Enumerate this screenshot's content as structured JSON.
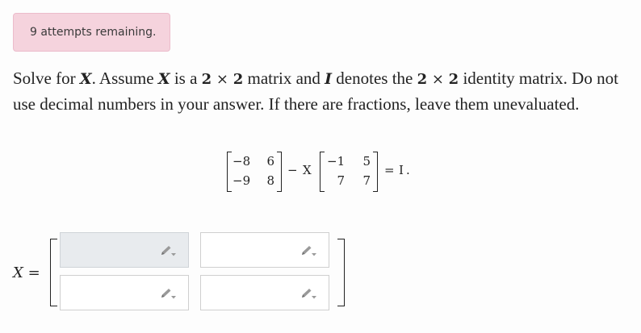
{
  "attempts": {
    "label": "9 attempts remaining."
  },
  "problem": {
    "t1": "Solve for ",
    "x1": "X",
    "t2": ". Assume ",
    "x2": "X",
    "t3": " is a ",
    "n1": "2",
    "times1": " × ",
    "n2": "2",
    "t4": " matrix and ",
    "i1": "I",
    "t5": " denotes the ",
    "n3": "2",
    "times2": " × ",
    "n4": "2",
    "t6": " identity matrix. Do not use decimal numbers in your answer. If there are fractions, leave them unevaluated."
  },
  "equation": {
    "matrix_a": [
      [
        "−8",
        "6"
      ],
      [
        "−9",
        "8"
      ]
    ],
    "minus": "−",
    "var": "X",
    "matrix_b": [
      [
        "−1",
        "5"
      ],
      [
        "7",
        "7"
      ]
    ],
    "equals": "=",
    "rhs": "I",
    "period": "."
  },
  "answer": {
    "var": "X",
    "equals": "=",
    "cells": [
      {
        "value": "",
        "icon": "pencil-icon"
      },
      {
        "value": "",
        "icon": "pencil-icon"
      },
      {
        "value": "",
        "icon": "pencil-icon"
      },
      {
        "value": "",
        "icon": "pencil-icon"
      }
    ]
  }
}
